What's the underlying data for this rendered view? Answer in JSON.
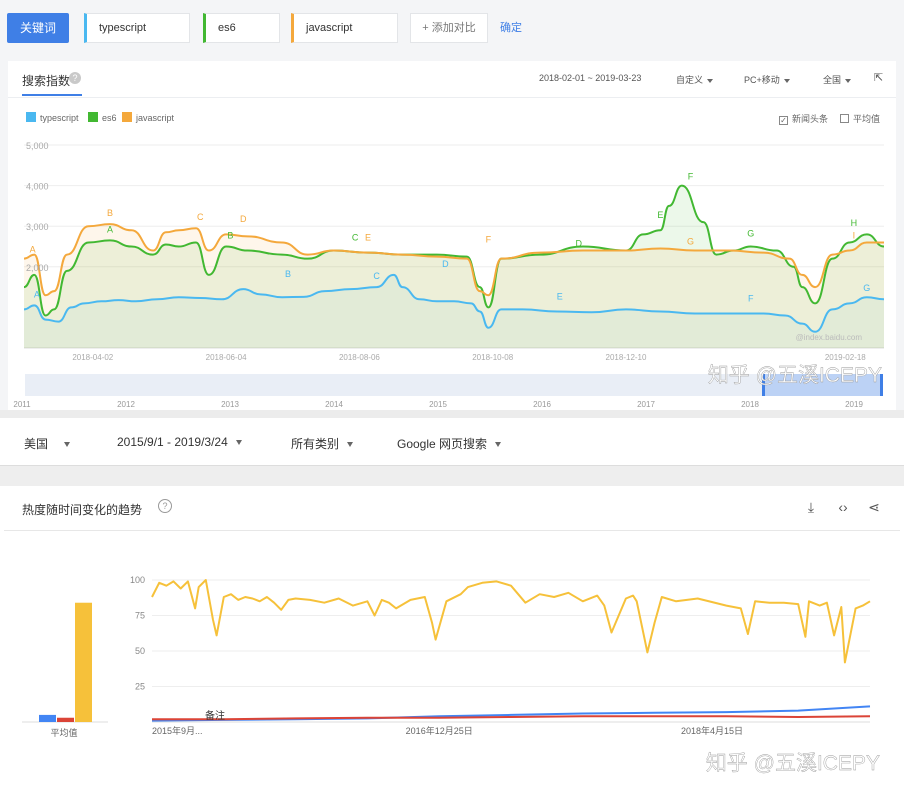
{
  "baidu": {
    "keyword_button": "关键词",
    "keywords": [
      {
        "label": "typescript",
        "color": "#4ab8f0"
      },
      {
        "label": "es6",
        "color": "#42b832"
      },
      {
        "label": "javascript",
        "color": "#f4a83c"
      }
    ],
    "add_compare": "+ 添加对比",
    "confirm": "确定",
    "panel_title": "搜索指数",
    "help": "?",
    "date_range": "2018-02-01 ~ 2019-03-23",
    "custom": "自定义",
    "device": "PC+移动",
    "region": "全国",
    "news_toggle": "新闻头条",
    "avg_toggle": "平均值",
    "watermark": "@index.baidu.com",
    "credit": "知乎 @五溪ICEPY"
  },
  "google": {
    "region": "美国",
    "date_range": "2015/9/1 - 2019/3/24",
    "category": "所有类别",
    "search_type": "Google 网页搜索",
    "title": "热度随时间变化的趋势",
    "help": "?",
    "avg_label": "平均值",
    "note": "备注",
    "credit": "知乎 @五溪ICEPY"
  },
  "chart_data": [
    {
      "type": "line",
      "title": "",
      "ylim": [
        0,
        5000
      ],
      "yticks": [
        "5,000",
        "4,000",
        "3,000",
        "2,000"
      ],
      "y_tick_values": [
        5000,
        4000,
        3000,
        2000
      ],
      "x_tick_labels": [
        "2018-04-02",
        "2018-06-04",
        "2018-08-06",
        "2018-10-08",
        "2018-12-10",
        "2019-02-18"
      ],
      "x_tick_positions": [
        0.08,
        0.235,
        0.39,
        0.545,
        0.7,
        0.955
      ],
      "legend_position": "top-left",
      "grid": true,
      "series": [
        {
          "name": "typescript",
          "color": "#4ab8f0",
          "x": [
            0,
            0.012,
            0.025,
            0.04,
            0.055,
            0.07,
            0.09,
            0.11,
            0.13,
            0.155,
            0.18,
            0.205,
            0.23,
            0.255,
            0.275,
            0.3,
            0.325,
            0.35,
            0.38,
            0.41,
            0.43,
            0.44,
            0.46,
            0.48,
            0.5,
            0.52,
            0.53,
            0.54,
            0.555,
            0.58,
            0.62,
            0.66,
            0.7,
            0.74,
            0.78,
            0.82,
            0.86,
            0.885,
            0.905,
            0.92,
            0.94,
            0.96,
            0.98,
            1.0
          ],
          "y": [
            950,
            1050,
            700,
            650,
            1000,
            1100,
            1150,
            1180,
            1150,
            1200,
            1250,
            1230,
            1200,
            1450,
            1320,
            1250,
            1260,
            1400,
            1450,
            1500,
            1800,
            1500,
            1200,
            1150,
            1150,
            1100,
            900,
            500,
            950,
            950,
            900,
            880,
            950,
            900,
            850,
            850,
            850,
            800,
            600,
            400,
            950,
            1100,
            1250,
            1200
          ]
        },
        {
          "name": "es6",
          "color": "#42b832",
          "x": [
            0,
            0.012,
            0.025,
            0.035,
            0.05,
            0.075,
            0.1,
            0.125,
            0.15,
            0.165,
            0.18,
            0.2,
            0.215,
            0.235,
            0.26,
            0.3,
            0.33,
            0.36,
            0.4,
            0.44,
            0.48,
            0.515,
            0.53,
            0.54,
            0.555,
            0.6,
            0.65,
            0.7,
            0.72,
            0.74,
            0.75,
            0.765,
            0.79,
            0.805,
            0.825,
            0.845,
            0.875,
            0.895,
            0.905,
            0.92,
            0.94,
            0.96,
            0.98,
            1.0
          ],
          "y": [
            1500,
            1800,
            800,
            950,
            1900,
            2600,
            2650,
            2500,
            2300,
            2550,
            2500,
            2600,
            1800,
            2500,
            2400,
            2300,
            2200,
            2400,
            2350,
            2300,
            2300,
            2250,
            1500,
            1000,
            2200,
            2300,
            2500,
            2400,
            2800,
            2900,
            3500,
            4000,
            3100,
            2300,
            2400,
            2500,
            2400,
            2000,
            1500,
            1100,
            2200,
            2600,
            2800,
            2500
          ]
        },
        {
          "name": "javascript",
          "color": "#f4a83c",
          "x": [
            0,
            0.012,
            0.025,
            0.035,
            0.05,
            0.075,
            0.1,
            0.125,
            0.15,
            0.165,
            0.18,
            0.2,
            0.215,
            0.235,
            0.26,
            0.3,
            0.33,
            0.36,
            0.4,
            0.44,
            0.48,
            0.515,
            0.53,
            0.54,
            0.555,
            0.6,
            0.65,
            0.7,
            0.74,
            0.78,
            0.82,
            0.86,
            0.89,
            0.905,
            0.92,
            0.94,
            0.96,
            0.98,
            1.0
          ],
          "y": [
            2200,
            2300,
            1300,
            1400,
            2300,
            3000,
            3050,
            2900,
            2400,
            2850,
            2900,
            2950,
            2400,
            2800,
            2750,
            2600,
            2300,
            2400,
            2350,
            2300,
            2250,
            2200,
            1400,
            1300,
            2200,
            2350,
            2400,
            2400,
            2450,
            2400,
            2400,
            2350,
            2200,
            1800,
            1500,
            2300,
            2400,
            2600,
            2600
          ]
        }
      ],
      "annotations": [
        {
          "series": "javascript",
          "label": "A",
          "x": 0.01,
          "y": 2350
        },
        {
          "series": "javascript",
          "label": "B",
          "x": 0.1,
          "y": 3250
        },
        {
          "series": "es6",
          "label": "A",
          "x": 0.1,
          "y": 2850
        },
        {
          "series": "javascript",
          "label": "C",
          "x": 0.205,
          "y": 3150
        },
        {
          "series": "javascript",
          "label": "D",
          "x": 0.255,
          "y": 3100
        },
        {
          "series": "es6",
          "label": "B",
          "x": 0.24,
          "y": 2700
        },
        {
          "series": "es6",
          "label": "C",
          "x": 0.385,
          "y": 2650
        },
        {
          "series": "javascript",
          "label": "E",
          "x": 0.4,
          "y": 2650
        },
        {
          "series": "typescript",
          "label": "A",
          "x": 0.015,
          "y": 1250
        },
        {
          "series": "typescript",
          "label": "B",
          "x": 0.307,
          "y": 1750
        },
        {
          "series": "typescript",
          "label": "C",
          "x": 0.41,
          "y": 1700
        },
        {
          "series": "typescript",
          "label": "D",
          "x": 0.49,
          "y": 2000
        },
        {
          "series": "javascript",
          "label": "F",
          "x": 0.54,
          "y": 2600
        },
        {
          "series": "es6",
          "label": "D",
          "x": 0.645,
          "y": 2500
        },
        {
          "series": "typescript",
          "label": "E",
          "x": 0.623,
          "y": 1200
        },
        {
          "series": "es6",
          "label": "E",
          "x": 0.74,
          "y": 3200
        },
        {
          "series": "es6",
          "label": "F",
          "x": 0.775,
          "y": 4150
        },
        {
          "series": "javascript",
          "label": "G",
          "x": 0.775,
          "y": 2550
        },
        {
          "series": "es6",
          "label": "G",
          "x": 0.845,
          "y": 2750
        },
        {
          "series": "typescript",
          "label": "F",
          "x": 0.845,
          "y": 1150
        },
        {
          "series": "es6",
          "label": "H",
          "x": 0.965,
          "y": 3000
        },
        {
          "series": "javascript",
          "label": "I",
          "x": 0.965,
          "y": 2700
        },
        {
          "series": "typescript",
          "label": "G",
          "x": 0.98,
          "y": 1400
        }
      ],
      "navigator_years": [
        "2011",
        "2012",
        "2013",
        "2014",
        "2015",
        "2016",
        "2017",
        "2018",
        "2019"
      ]
    },
    {
      "type": "line",
      "title": "",
      "ylim": [
        0,
        100
      ],
      "yticks": [
        "100",
        "75",
        "50",
        "25"
      ],
      "y_tick_values": [
        100,
        75,
        50,
        25
      ],
      "x_tick_labels": [
        "2015年9月...",
        "2016年12月25日",
        "2018年4月15日"
      ],
      "x_tick_positions": [
        0.0,
        0.4,
        0.78
      ],
      "series": [
        {
          "name": "javascript",
          "color": "#f6c13a",
          "x": [
            0,
            0.01,
            0.02,
            0.03,
            0.04,
            0.05,
            0.06,
            0.065,
            0.075,
            0.085,
            0.09,
            0.1,
            0.11,
            0.12,
            0.13,
            0.14,
            0.15,
            0.16,
            0.17,
            0.18,
            0.19,
            0.2,
            0.22,
            0.24,
            0.26,
            0.28,
            0.3,
            0.31,
            0.32,
            0.33,
            0.34,
            0.36,
            0.38,
            0.39,
            0.395,
            0.41,
            0.43,
            0.44,
            0.46,
            0.48,
            0.5,
            0.52,
            0.54,
            0.56,
            0.58,
            0.6,
            0.62,
            0.63,
            0.64,
            0.66,
            0.67,
            0.675,
            0.69,
            0.7,
            0.71,
            0.73,
            0.76,
            0.8,
            0.82,
            0.83,
            0.84,
            0.86,
            0.88,
            0.9,
            0.91,
            0.915,
            0.93,
            0.94,
            0.95,
            0.96,
            0.965,
            0.98,
            0.99,
            1.0
          ],
          "y": [
            88,
            98,
            96,
            99,
            94,
            99,
            80,
            95,
            100,
            72,
            61,
            88,
            90,
            86,
            88,
            87,
            85,
            88,
            84,
            79,
            86,
            87,
            86,
            84,
            87,
            82,
            85,
            75,
            86,
            84,
            80,
            86,
            88,
            70,
            58,
            85,
            90,
            95,
            98,
            99,
            96,
            84,
            90,
            88,
            91,
            85,
            89,
            82,
            63,
            87,
            89,
            85,
            49,
            70,
            88,
            85,
            87,
            82,
            80,
            62,
            85,
            84,
            84,
            83,
            60,
            85,
            82,
            84,
            61,
            81,
            42,
            80,
            82,
            85
          ]
        },
        {
          "name": "typescript",
          "color": "#4285f4",
          "x": [
            0,
            0.1,
            0.2,
            0.3,
            0.4,
            0.5,
            0.6,
            0.7,
            0.8,
            0.9,
            1.0
          ],
          "y": [
            1,
            1.5,
            2,
            2.5,
            4,
            5,
            6,
            6.5,
            7,
            8,
            11
          ]
        },
        {
          "name": "es6",
          "color": "#db4437",
          "x": [
            0,
            0.1,
            0.2,
            0.3,
            0.4,
            0.5,
            0.6,
            0.7,
            0.8,
            0.9,
            1.0
          ],
          "y": [
            2,
            2,
            2.5,
            3,
            3,
            3.5,
            4,
            4,
            4,
            3.5,
            4
          ]
        }
      ],
      "averages": [
        {
          "name": "typescript",
          "color": "#4285f4",
          "value": 5
        },
        {
          "name": "es6",
          "color": "#db4437",
          "value": 3
        },
        {
          "name": "javascript",
          "color": "#f6c13a",
          "value": 84
        }
      ]
    }
  ]
}
